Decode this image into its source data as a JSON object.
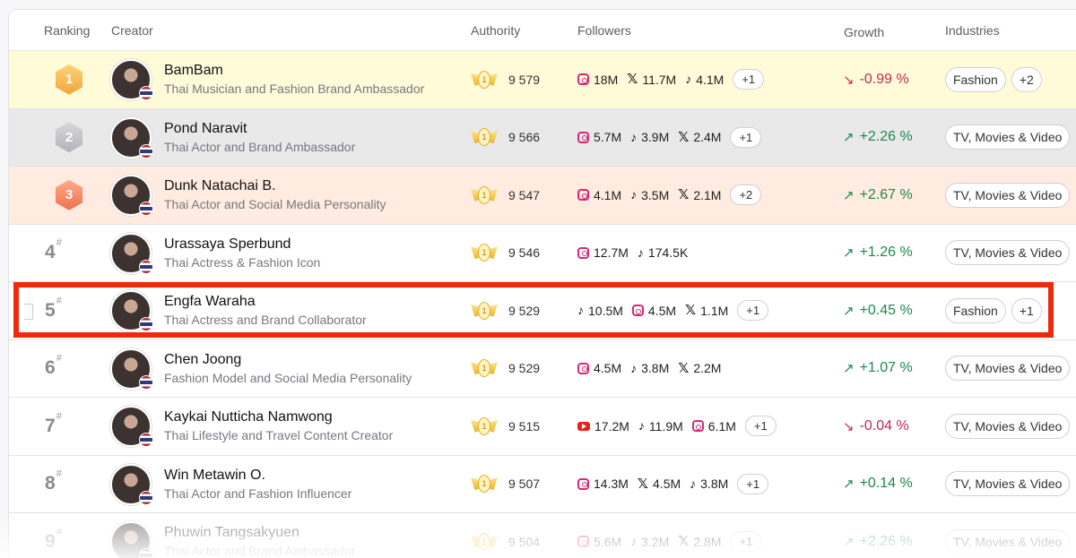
{
  "header": {
    "ranking": "Ranking",
    "creator": "Creator",
    "authority": "Authority",
    "followers": "Followers",
    "growth": "Growth",
    "industries": "Industries"
  },
  "rows": [
    {
      "rank": "1",
      "medal": "gold",
      "name": "BamBam",
      "subtitle": "Thai Musician and Fashion Brand Ambassador",
      "authority": "9 579",
      "followers": [
        {
          "icon": "instagram-icon",
          "value": "18M"
        },
        {
          "icon": "x-icon",
          "value": "11.7M"
        },
        {
          "icon": "tiktok-icon",
          "value": "4.1M"
        }
      ],
      "more": "+1",
      "growth": "-0.99 %",
      "trend": "down",
      "industries": [
        "Fashion",
        "+2"
      ]
    },
    {
      "rank": "2",
      "medal": "silver",
      "name": "Pond Naravit",
      "subtitle": "Thai Actor and Brand Ambassador",
      "authority": "9 566",
      "followers": [
        {
          "icon": "instagram-icon",
          "value": "5.7M"
        },
        {
          "icon": "tiktok-icon",
          "value": "3.9M"
        },
        {
          "icon": "x-icon",
          "value": "2.4M"
        }
      ],
      "more": "+1",
      "growth": "+2.26 %",
      "trend": "up",
      "industries": [
        "TV, Movies & Video"
      ]
    },
    {
      "rank": "3",
      "medal": "bronze",
      "name": "Dunk Natachai B.",
      "subtitle": "Thai Actor and Social Media Personality",
      "authority": "9 547",
      "followers": [
        {
          "icon": "instagram-icon",
          "value": "4.1M"
        },
        {
          "icon": "tiktok-icon",
          "value": "3.5M"
        },
        {
          "icon": "x-icon",
          "value": "2.1M"
        }
      ],
      "more": "+2",
      "growth": "+2.67 %",
      "trend": "up",
      "industries": [
        "TV, Movies & Video"
      ]
    },
    {
      "rank": "4",
      "medal": "",
      "name": "Urassaya Sperbund",
      "subtitle": "Thai Actress & Fashion Icon",
      "authority": "9 546",
      "followers": [
        {
          "icon": "instagram-icon",
          "value": "12.7M"
        },
        {
          "icon": "tiktok-icon",
          "value": "174.5K"
        }
      ],
      "more": "",
      "growth": "+1.26 %",
      "trend": "up",
      "industries": [
        "TV, Movies & Video"
      ]
    },
    {
      "rank": "5",
      "medal": "",
      "name": "Engfa Waraha",
      "subtitle": "Thai Actress and Brand Collaborator",
      "authority": "9 529",
      "followers": [
        {
          "icon": "tiktok-icon",
          "value": "10.5M"
        },
        {
          "icon": "instagram-icon",
          "value": "4.5M"
        },
        {
          "icon": "x-icon",
          "value": "1.1M"
        }
      ],
      "more": "+1",
      "growth": "+0.45 %",
      "trend": "up",
      "industries": [
        "Fashion",
        "+1"
      ]
    },
    {
      "rank": "6",
      "medal": "",
      "name": "Chen Joong",
      "subtitle": "Fashion Model and Social Media Personality",
      "authority": "9 529",
      "followers": [
        {
          "icon": "instagram-icon",
          "value": "4.5M"
        },
        {
          "icon": "tiktok-icon",
          "value": "3.8M"
        },
        {
          "icon": "x-icon",
          "value": "2.2M"
        }
      ],
      "more": "",
      "growth": "+1.07 %",
      "trend": "up",
      "industries": [
        "TV, Movies & Video"
      ]
    },
    {
      "rank": "7",
      "medal": "",
      "name": "Kaykai Nutticha Namwong",
      "subtitle": "Thai Lifestyle and Travel Content Creator",
      "authority": "9 515",
      "followers": [
        {
          "icon": "youtube-icon",
          "value": "17.2M"
        },
        {
          "icon": "tiktok-icon",
          "value": "11.9M"
        },
        {
          "icon": "instagram-icon",
          "value": "6.1M"
        }
      ],
      "more": "+1",
      "growth": "-0.04 %",
      "trend": "down",
      "industries": [
        "TV, Movies & Video"
      ]
    },
    {
      "rank": "8",
      "medal": "",
      "name": "Win Metawin O.",
      "subtitle": "Thai Actor and Fashion Influencer",
      "authority": "9 507",
      "followers": [
        {
          "icon": "instagram-icon",
          "value": "14.3M"
        },
        {
          "icon": "x-icon",
          "value": "4.5M"
        },
        {
          "icon": "tiktok-icon",
          "value": "3.8M"
        }
      ],
      "more": "+1",
      "growth": "+0.14 %",
      "trend": "up",
      "industries": [
        "TV, Movies & Video"
      ]
    },
    {
      "rank": "9",
      "medal": "",
      "name": "Phuwin Tangsakyuen",
      "subtitle": "Thai Actor and Brand Ambassador",
      "authority": "9 504",
      "followers": [
        {
          "icon": "instagram-icon",
          "value": "5.6M"
        },
        {
          "icon": "tiktok-icon",
          "value": "3.2M"
        },
        {
          "icon": "x-icon",
          "value": "2.8M"
        }
      ],
      "more": "+1",
      "growth": "+2.26 %",
      "trend": "up",
      "industries": [
        "TV, Movies & Video"
      ]
    }
  ],
  "authority_badge_label": "1",
  "highlight_row": "5",
  "colors": {
    "highlight": "#ee2a0e",
    "growth_up": "#1b8a4d",
    "growth_down": "#c52a52"
  }
}
